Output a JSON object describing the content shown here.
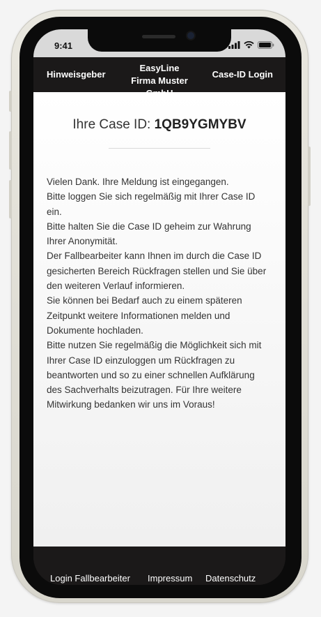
{
  "status_bar": {
    "time": "9:41"
  },
  "header": {
    "left_link": "Hinweisgeber",
    "brand_line1": "EasyLine",
    "brand_line2": "Firma Muster GmbH",
    "right_link": "Case-ID Login"
  },
  "main": {
    "case_label": "Ihre Case ID:",
    "case_id": "1QB9YGMYBV",
    "message_paragraphs": [
      "Vielen Dank. Ihre Meldung ist eingegangen.",
      "Bitte loggen Sie sich regelmäßig mit Ihrer Case ID ein.",
      "Bitte halten Sie die Case ID geheim zur Wahrung Ihrer Anonymität.",
      "Der Fallbearbeiter kann Ihnen im durch die Case ID gesicherten Bereich Rückfragen stellen und Sie über den weiteren Verlauf informieren.",
      "Sie können bei Bedarf auch zu einem späteren Zeitpunkt weitere Informationen melden und Dokumente hochladen.",
      "Bitte nutzen Sie regelmäßig die Möglichkeit sich mit Ihrer Case ID einzuloggen um Rückfragen zu beantworten und so zu einer schnellen Aufklärung des Sachverhalts beizutragen. Für Ihre weitere Mitwirkung bedanken wir uns im Voraus!"
    ]
  },
  "footer": {
    "links": [
      "Login Fallbearbeiter",
      "Impressum",
      "Datenschutz"
    ]
  },
  "colors": {
    "bar_background": "#1b1919",
    "content_background": "#ffffff",
    "text": "#333333",
    "phone_frame": "#e9e7df"
  }
}
